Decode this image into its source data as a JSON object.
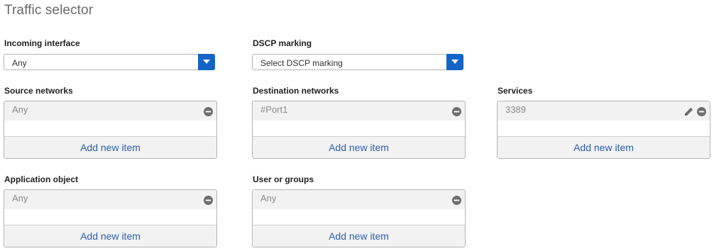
{
  "section_title": "Traffic selector",
  "incoming_interface": {
    "label": "Incoming interface",
    "value": "Any"
  },
  "dscp_marking": {
    "label": "DSCP marking",
    "value": "Select DSCP marking"
  },
  "source_networks": {
    "label": "Source networks",
    "items": [
      "Any"
    ],
    "add_label": "Add new item"
  },
  "destination_networks": {
    "label": "Destination networks",
    "items": [
      "#Port1"
    ],
    "add_label": "Add new item"
  },
  "services": {
    "label": "Services",
    "items": [
      "3389"
    ],
    "add_label": "Add new item"
  },
  "application_object": {
    "label": "Application object",
    "items": [
      "Any"
    ],
    "add_label": "Add new item"
  },
  "user_or_groups": {
    "label": "User or groups",
    "items": [
      "Any"
    ],
    "add_label": "Add new item"
  },
  "colors": {
    "accent": "#1464c8",
    "link": "#2a5fb0",
    "icon": "#6e6e6e"
  },
  "icons": {
    "dropdown": "caret-down-icon",
    "remove": "minus-circle-icon",
    "edit": "pencil-icon"
  }
}
